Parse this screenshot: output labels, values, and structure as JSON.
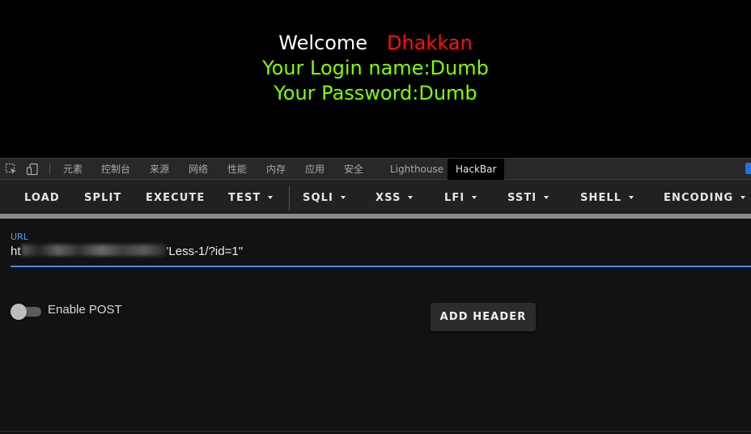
{
  "page": {
    "welcome": "Welcome",
    "username": "Dhakkan",
    "login_line": "Your Login name:Dumb",
    "password_line": "Your Password:Dumb"
  },
  "devtools": {
    "tabs": [
      "元素",
      "控制台",
      "来源",
      "网络",
      "性能",
      "内存",
      "应用",
      "安全",
      "Lighthouse",
      "HackBar"
    ],
    "active_tab": "HackBar"
  },
  "hackbar": {
    "menu": {
      "load": "LOAD",
      "split": "SPLIT",
      "execute": "EXECUTE",
      "test": "TEST",
      "sqli": "SQLI",
      "xss": "XSS",
      "lfi": "LFI",
      "ssti": "SSTI",
      "shell": "SHELL",
      "encoding": "ENCODING"
    },
    "url_label": "URL",
    "url_prefix": "ht",
    "url_suffix": "'Less-1/?id=1\"",
    "enable_post_label": "Enable POST",
    "enable_post_on": false,
    "add_header_label": "ADD HEADER"
  },
  "colors": {
    "welcome": "#ffffff",
    "username": "#ff1010",
    "info": "#80ff00",
    "accent": "#3d8ee8"
  }
}
